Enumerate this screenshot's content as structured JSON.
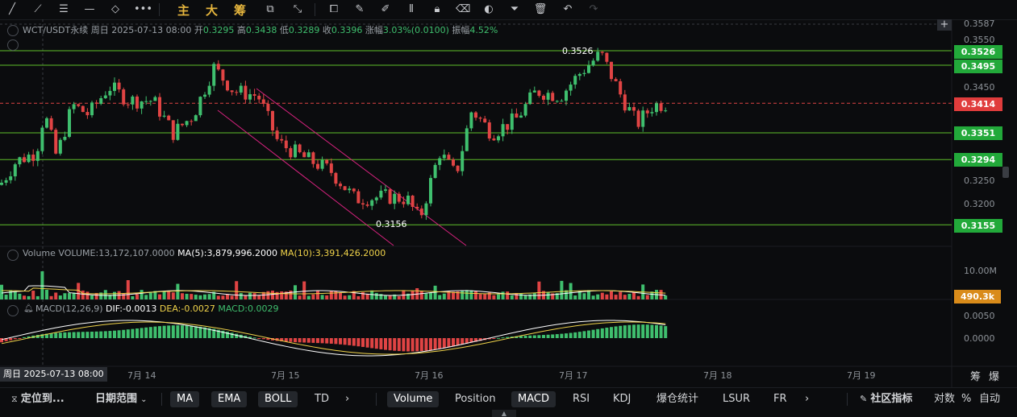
{
  "toolbar": {
    "icons": [
      "line-tool-icon",
      "ray-tool-icon",
      "horizontal-lines-icon",
      "horizontal-line-icon",
      "pattern-icon",
      "more-tools-icon",
      "text-icon",
      "brush-icon",
      "fib-icon",
      "shape-icon",
      "measure-icon",
      "copy-icon",
      "pencil-icon",
      "highlighter-icon",
      "indicator-icon",
      "lock-icon",
      "eraser-icon",
      "palette-icon",
      "filter-icon",
      "delete-icon",
      "undo-icon",
      "redo-icon"
    ],
    "cn_main": "主",
    "cn_big": "大",
    "cn_chips": "筹"
  },
  "symbol_info": {
    "symbol": "WCT/USDT永续",
    "period": "周日 2025-07-13 08:00",
    "open_label": "开",
    "open": "0.3295",
    "high_label": "高",
    "high": "0.3438",
    "low_label": "低",
    "low": "0.3289",
    "close_label": "收",
    "close": "0.3396",
    "change_label": "涨幅",
    "change": "3.03%(0.0100)",
    "amp_label": "振幅",
    "amp": "4.52%"
  },
  "price_axis": {
    "ticks": [
      "0.3587",
      "0.3550",
      "0.3450",
      "0.3250",
      "0.3200"
    ],
    "tags": [
      {
        "value": "0.3526",
        "color": "#22a93a"
      },
      {
        "value": "0.3495",
        "color": "#22a93a"
      },
      {
        "value": "0.3414",
        "color": "#e03c3c"
      },
      {
        "value": "0.3351",
        "color": "#22a93a"
      },
      {
        "value": "0.3294",
        "color": "#22a93a"
      },
      {
        "value": "0.3155",
        "color": "#22a93a"
      }
    ],
    "volume_ticks": [
      "10.00M"
    ],
    "volume_tag": {
      "value": "490.3k",
      "color": "#d98b1a"
    },
    "macd_ticks": [
      "0.0050",
      "0.0000"
    ]
  },
  "annotations": {
    "high_mark": "0.3526",
    "low_mark": "0.3156"
  },
  "volume_info": {
    "label": "Volume",
    "volume": "VOLUME:13,172,107.0000",
    "ma5": "MA(5):3,879,996.2000",
    "ma10": "MA(10):3,391,426.2000"
  },
  "macd_info": {
    "label": "MACD(12,26,9)",
    "dif": "DIF:-0.0013",
    "dea": "DEA:-0.0027",
    "macd": "MACD:0.0029"
  },
  "time_axis": {
    "current": "周日 2025-07-13 08:00",
    "labels": [
      "7月 14",
      "7月 15",
      "7月 16",
      "7月 17",
      "7月 18",
      "7月 19"
    ],
    "right_btn1": "筹",
    "right_btn2": "爆"
  },
  "bottom_bar": {
    "locate": "定位到...",
    "date_range": "日期范围",
    "indicators_main": [
      "MA",
      "EMA",
      "BOLL",
      "TD"
    ],
    "indicators_sub": [
      "Volume",
      "Position",
      "MACD",
      "RSI",
      "KDJ",
      "爆仓统计",
      "LSUR",
      "FR"
    ],
    "community": "社区指标",
    "log": "对数",
    "percent": "%",
    "auto": "自动"
  },
  "colors": {
    "up": "#3fbf6e",
    "down": "#e04444",
    "level_line": "#5fbf2a",
    "channel": "#d6227e",
    "ma5": "#ffffff",
    "ma10": "#f0d34a"
  }
}
